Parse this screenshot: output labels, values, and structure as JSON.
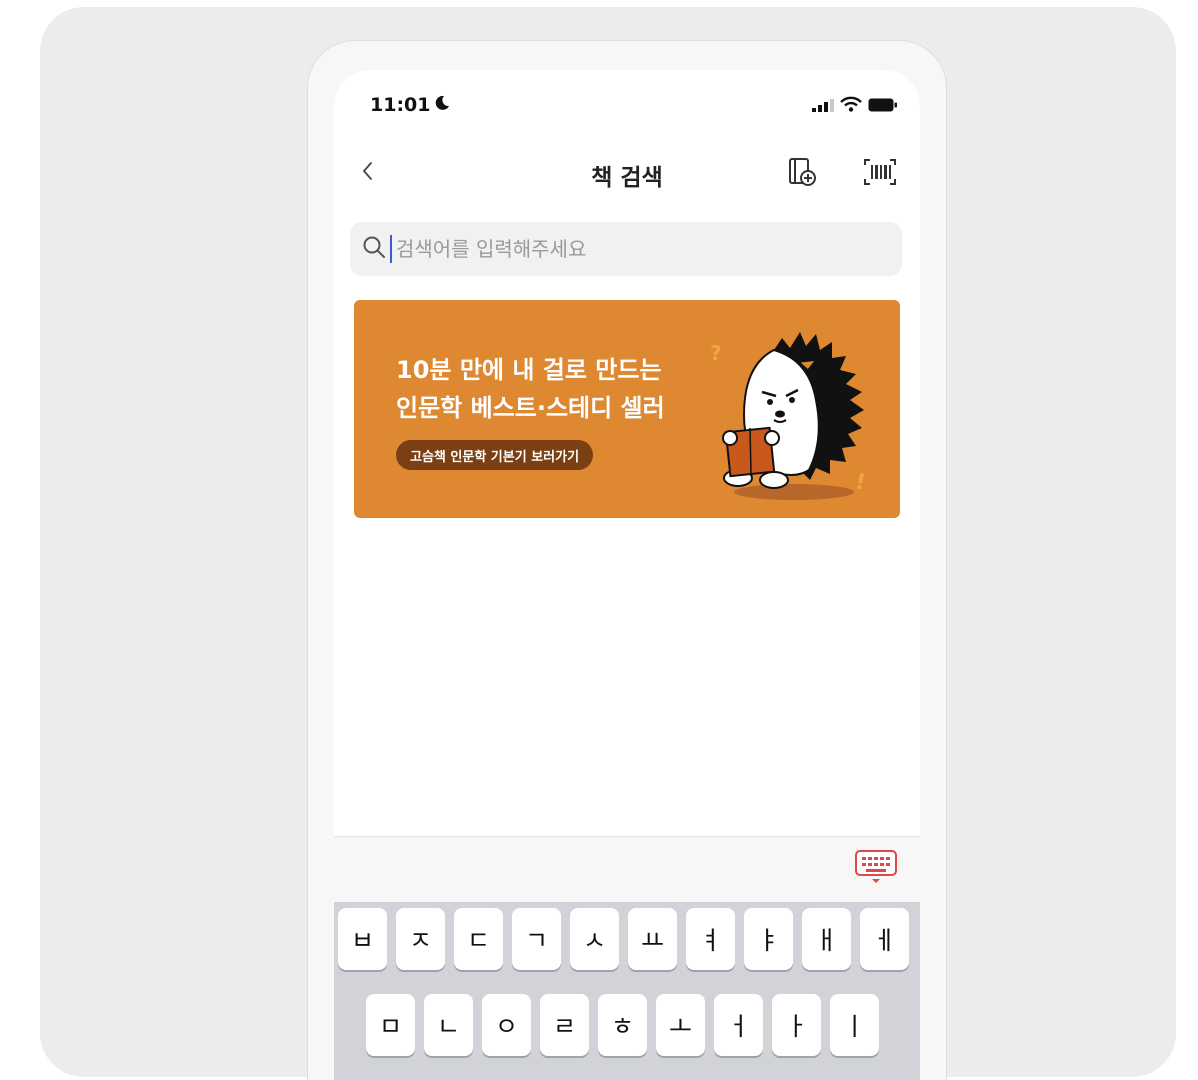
{
  "status_bar": {
    "time": "11:01",
    "icons": [
      "moon-icon",
      "signal-icon",
      "wifi-icon",
      "battery-icon"
    ]
  },
  "header": {
    "title": "책 검색",
    "icons": [
      "back-chevron-icon",
      "add-book-icon",
      "barcode-scan-icon"
    ]
  },
  "search": {
    "placeholder": "검색어를 입력해주세요",
    "value": ""
  },
  "banner": {
    "line1": "10분 만에 내 걸로 만드는",
    "line2": "인문학 베스트·스테디 셀러",
    "button_label": "고슴책 인문학 기본기 보러가기",
    "color": "#de8832",
    "button_color": "#7a3f12"
  },
  "keyboard": {
    "toggle_icon": "keyboard-hide-icon",
    "row1": [
      "ㅂ",
      "ㅈ",
      "ㄷ",
      "ㄱ",
      "ㅅ",
      "ㅛ",
      "ㅕ",
      "ㅑ",
      "ㅐ",
      "ㅔ"
    ],
    "row2": [
      "ㅁ",
      "ㄴ",
      "ㅇ",
      "ㄹ",
      "ㅎ",
      "ㅗ",
      "ㅓ",
      "ㅏ",
      "ㅣ"
    ]
  },
  "colors": {
    "accent_caret": "#3b5bdb",
    "keyboard_toggle": "#e0474c"
  }
}
